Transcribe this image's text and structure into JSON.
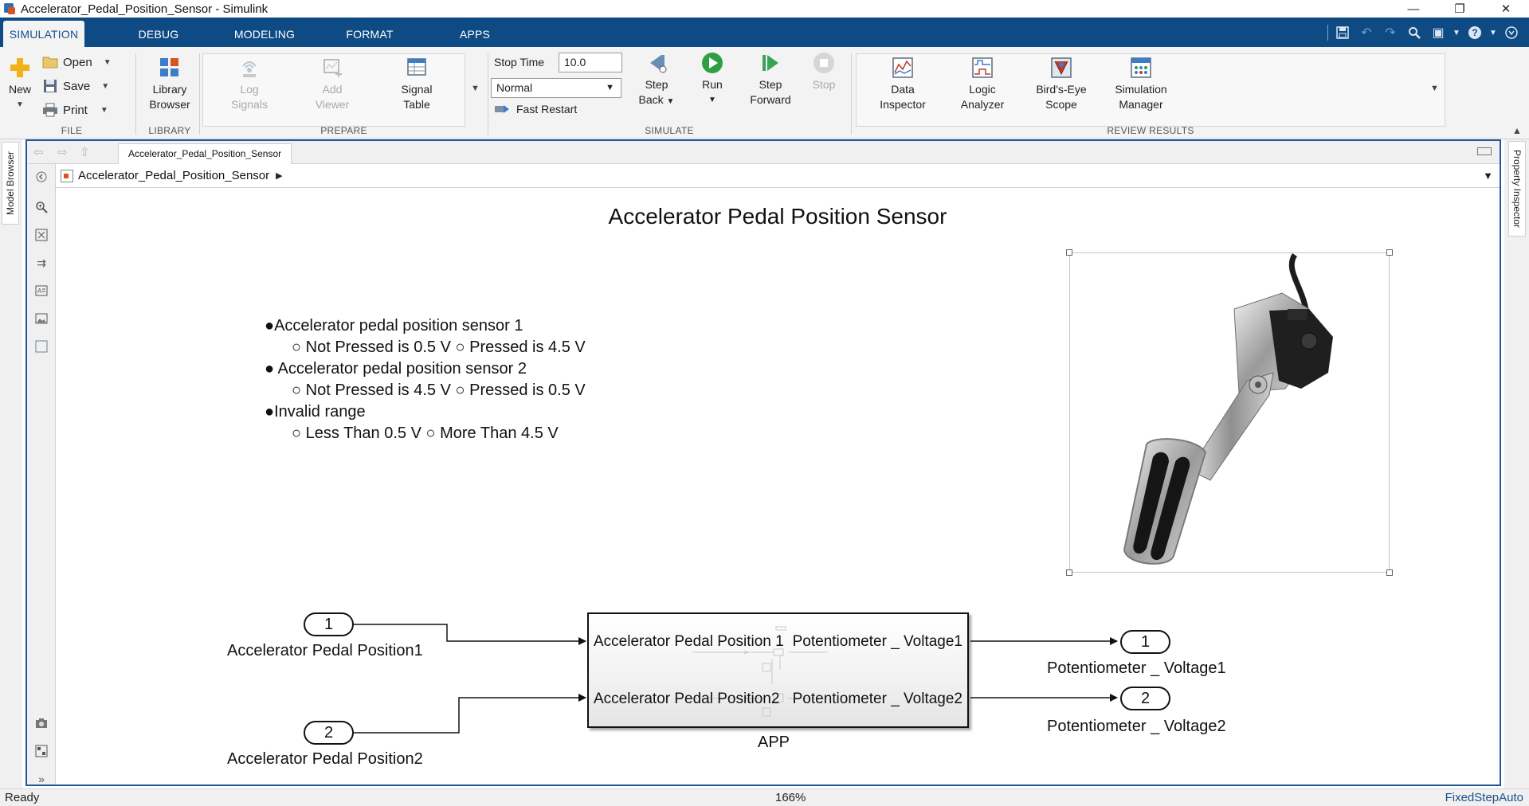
{
  "window": {
    "title": "Accelerator_Pedal_Position_Sensor - Simulink",
    "controls": [
      "—",
      "❐",
      "✕"
    ]
  },
  "tabs": [
    "SIMULATION",
    "DEBUG",
    "MODELING",
    "FORMAT",
    "APPS"
  ],
  "active_tab": "SIMULATION",
  "ribbon": {
    "file": {
      "label": "FILE",
      "new": "New",
      "open": "Open",
      "save": "Save",
      "print": "Print"
    },
    "library": {
      "label": "LIBRARY",
      "library_browser_1": "Library",
      "library_browser_2": "Browser"
    },
    "prepare": {
      "label": "PREPARE",
      "log_signals_1": "Log",
      "log_signals_2": "Signals",
      "add_viewer_1": "Add",
      "add_viewer_2": "Viewer",
      "signal_table_1": "Signal",
      "signal_table_2": "Table"
    },
    "simulate": {
      "label": "SIMULATE",
      "stop_time_label": "Stop Time",
      "stop_time_value": "10.0",
      "mode": "Normal",
      "fast_restart": "Fast Restart",
      "step_back_1": "Step",
      "step_back_2": "Back",
      "run": "Run",
      "step_forward_1": "Step",
      "step_forward_2": "Forward",
      "stop": "Stop"
    },
    "review": {
      "label": "REVIEW RESULTS",
      "data_inspector_1": "Data",
      "data_inspector_2": "Inspector",
      "logic_analyzer_1": "Logic",
      "logic_analyzer_2": "Analyzer",
      "birds_eye_1": "Bird's-Eye",
      "birds_eye_2": "Scope",
      "sim_manager_1": "Simulation",
      "sim_manager_2": "Manager"
    }
  },
  "side_tabs": {
    "left": "Model Browser",
    "right": "Property Inspector"
  },
  "editor": {
    "doc_tab": "Accelerator_Pedal_Position_Sensor",
    "breadcrumb": "Accelerator_Pedal_Position_Sensor"
  },
  "canvas": {
    "title": "Accelerator Pedal Position Sensor",
    "notes": [
      {
        "level": 0,
        "text": "●Accelerator pedal position sensor 1"
      },
      {
        "level": 1,
        "text": "○ Not Pressed is 0.5 V ○ Pressed is 4.5 V"
      },
      {
        "level": 0,
        "text": "● Accelerator pedal position sensor 2"
      },
      {
        "level": 1,
        "text": "○ Not Pressed is 4.5 V ○ Pressed is 0.5 V"
      },
      {
        "level": 0,
        "text": "●Invalid range"
      },
      {
        "level": 1,
        "text": "○ Less Than 0.5 V ○ More Than 4.5 V"
      }
    ],
    "inports": [
      {
        "num": "1",
        "label": "Accelerator Pedal Position1"
      },
      {
        "num": "2",
        "label": "Accelerator Pedal Position2"
      }
    ],
    "outports": [
      {
        "num": "1",
        "label": "Potentiometer _ Voltage1"
      },
      {
        "num": "2",
        "label": "Potentiometer _ Voltage2"
      }
    ],
    "subsystem": {
      "name": "APP",
      "in1": "Accelerator Pedal Position 1",
      "in2": "Accelerator Pedal Position2",
      "out1": "Potentiometer _ Voltage1",
      "out2": "Potentiometer _ Voltage2"
    }
  },
  "status": {
    "left": "Ready",
    "zoom": "166%",
    "solver": "FixedStepAuto"
  },
  "colors": {
    "tabstrip": "#0e4a84",
    "editor_border": "#1e5a9e",
    "run_green": "#2ea043"
  }
}
